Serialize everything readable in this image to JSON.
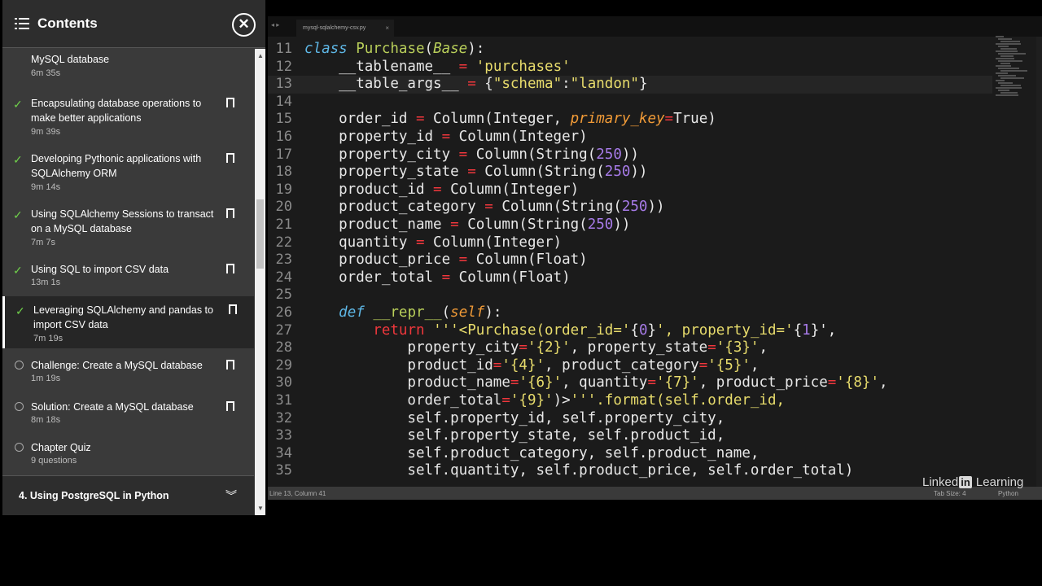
{
  "sidebar": {
    "title": "Contents",
    "items": [
      {
        "title": "MySQL database",
        "duration": "6m 35s",
        "status": "done",
        "active": false
      },
      {
        "title": "Encapsulating database operations to make better applications",
        "duration": "9m 39s",
        "status": "done",
        "active": false
      },
      {
        "title": "Developing Pythonic applications with SQLAlchemy ORM",
        "duration": "9m 14s",
        "status": "done",
        "active": false
      },
      {
        "title": "Using SQLAlchemy Sessions to transact on a MySQL database",
        "duration": "7m 7s",
        "status": "done",
        "active": false
      },
      {
        "title": "Using SQL to import CSV data",
        "duration": "13m 1s",
        "status": "done",
        "active": false
      },
      {
        "title": "Leveraging SQLAlchemy and pandas to import CSV data",
        "duration": "7m 19s",
        "status": "done",
        "active": true
      },
      {
        "title": "Challenge: Create a MySQL database",
        "duration": "1m 19s",
        "status": "todo",
        "active": false
      },
      {
        "title": "Solution: Create a MySQL database",
        "duration": "8m 18s",
        "status": "todo",
        "active": false
      },
      {
        "title": "Chapter Quiz",
        "duration": "9 questions",
        "status": "todo",
        "active": false
      }
    ],
    "section_label": "4. Using PostgreSQL in Python",
    "icons": {
      "menu": "hamburger-icon",
      "close": "close-icon",
      "check": "checkmark-icon",
      "bookmark": "bookmark-icon",
      "chevron": "chevron-down-icon"
    }
  },
  "editor": {
    "tab_label": "mysql-sqlalchemy-csv.py",
    "status_position": "Line 13, Column 41",
    "status_tab_size": "Tab Size: 4",
    "status_language": "Python",
    "current_line": 13,
    "lines": [
      {
        "n": "11",
        "t": "class Purchase(Base):"
      },
      {
        "n": "12",
        "t": "    __tablename__ = 'purchases'"
      },
      {
        "n": "13",
        "t": "    __table_args__ = {\"schema\":\"landon\"}"
      },
      {
        "n": "14",
        "t": ""
      },
      {
        "n": "15",
        "t": "    order_id = Column(Integer, primary_key=True)"
      },
      {
        "n": "16",
        "t": "    property_id = Column(Integer)"
      },
      {
        "n": "17",
        "t": "    property_city = Column(String(250))"
      },
      {
        "n": "18",
        "t": "    property_state = Column(String(250))"
      },
      {
        "n": "19",
        "t": "    product_id = Column(Integer)"
      },
      {
        "n": "20",
        "t": "    product_category = Column(String(250))"
      },
      {
        "n": "21",
        "t": "    product_name = Column(String(250))"
      },
      {
        "n": "22",
        "t": "    quantity = Column(Integer)"
      },
      {
        "n": "23",
        "t": "    product_price = Column(Float)"
      },
      {
        "n": "24",
        "t": "    order_total = Column(Float)"
      },
      {
        "n": "25",
        "t": ""
      },
      {
        "n": "26",
        "t": "    def __repr__(self):"
      },
      {
        "n": "27",
        "t": "        return '''<Purchase(order_id='{0}', property_id='{1}',"
      },
      {
        "n": "28",
        "t": "            property_city='{2}', property_state='{3}',"
      },
      {
        "n": "29",
        "t": "            product_id='{4}', product_category='{5}',"
      },
      {
        "n": "30",
        "t": "            product_name='{6}', quantity='{7}', product_price='{8}',"
      },
      {
        "n": "31",
        "t": "            order_total='{9}')>'''.format(self.order_id,"
      },
      {
        "n": "32",
        "t": "            self.property_id, self.property_city,"
      },
      {
        "n": "33",
        "t": "            self.property_state, self.product_id,"
      },
      {
        "n": "34",
        "t": "            self.product_category, self.product_name,"
      },
      {
        "n": "35",
        "t": "            self.quantity, self.product_price, self.order_total)"
      }
    ]
  },
  "brand": {
    "prefix": "Linked",
    "badge": "in",
    "suffix": " Learning"
  },
  "colors": {
    "check": "#6fcf4a",
    "keyword": "#5eb7e6",
    "string": "#e8dc6c",
    "number": "#a77be8",
    "operator": "#f0373c",
    "class": "#b9cf5a",
    "param": "#f09a37"
  }
}
